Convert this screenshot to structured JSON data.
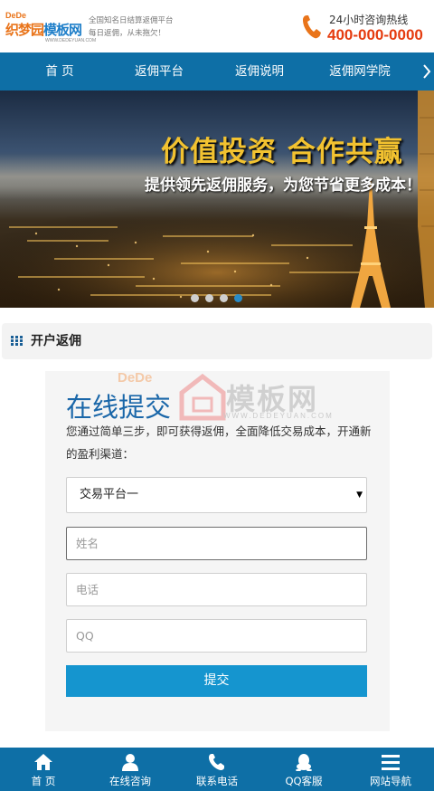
{
  "header": {
    "logo_dede": "DeDe",
    "logo_part1": "织梦",
    "logo_part2": "园",
    "logo_part3": "模板网",
    "logo_url": "WWW.DEDEYUAN.COM",
    "tagline_line1": "全国知名日结算返佣平台",
    "tagline_line2": "每日返佣，从未拖欠！",
    "hotline_label": "24小时咨询热线",
    "hotline_number": "400-000-0000"
  },
  "nav": {
    "items": [
      {
        "label": "首 页"
      },
      {
        "label": "返佣平台"
      },
      {
        "label": "返佣说明"
      },
      {
        "label": "返佣网学院"
      }
    ],
    "more_icon": "chevron-right-icon"
  },
  "banner": {
    "title": "价值投资 合作共赢",
    "subtitle": "提供领先返佣服务，为您节省更多成本！",
    "slide_count": 4,
    "active_slide": 4
  },
  "section": {
    "title": "开户返佣",
    "icon": "grid-icon"
  },
  "form": {
    "watermark_dede": "DeDe",
    "watermark_text": "模板网",
    "watermark_url": "WWW.DEDEYUAN.COM",
    "title": "在线提交",
    "description": "您通过简单三步，即可获得返佣，全面降低交易成本，开通新的盈利渠道：",
    "platform_select": "交易平台一",
    "name_placeholder": "姓名",
    "phone_placeholder": "电话",
    "qq_placeholder": "QQ",
    "submit_label": "提交"
  },
  "bottom_nav": {
    "items": [
      {
        "label": "首 页",
        "icon": "home-icon"
      },
      {
        "label": "在线咨询",
        "icon": "user-icon"
      },
      {
        "label": "联系电话",
        "icon": "phone-icon"
      },
      {
        "label": "QQ客服",
        "icon": "qq-icon"
      },
      {
        "label": "网站导航",
        "icon": "menu-icon"
      }
    ]
  },
  "colors": {
    "nav_blue": "#0e6fa6",
    "accent_red": "#e53c10",
    "brand_orange": "#e9741a",
    "button_blue": "#1595cf",
    "banner_gold": "#f2c230"
  }
}
